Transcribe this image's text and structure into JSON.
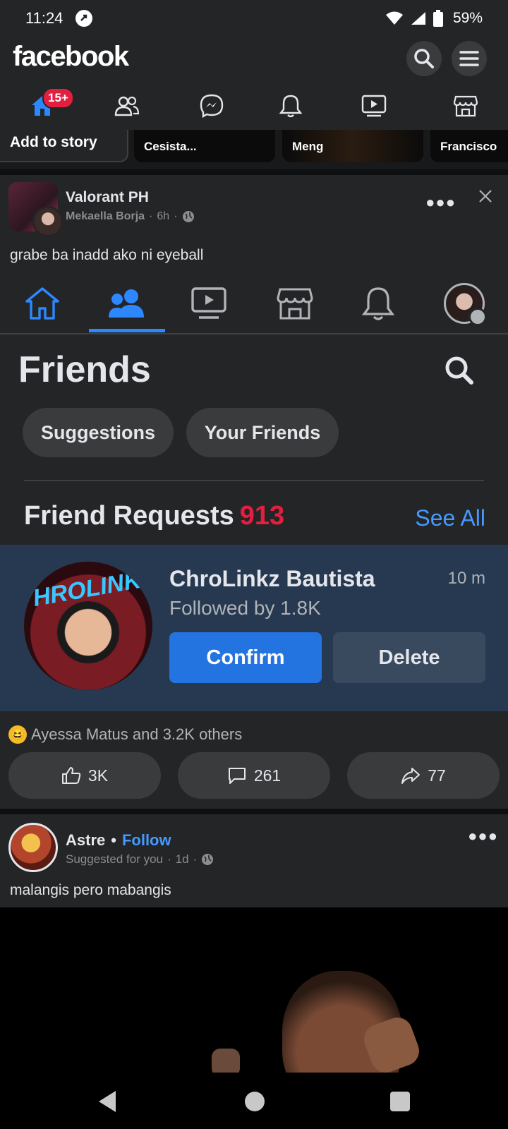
{
  "status": {
    "time": "11:24",
    "battery": "59%"
  },
  "header": {
    "logo": "facebook",
    "notif_badge": "15+"
  },
  "stories": [
    {
      "label": "Add to story"
    },
    {
      "label": "Cesista..."
    },
    {
      "label": "Meng"
    },
    {
      "label": "Francisco"
    }
  ],
  "post1": {
    "title": "Valorant PH",
    "author": "Mekaella Borja",
    "time": "6h",
    "text": "grabe ba inadd ako ni eyeball",
    "screenshot": {
      "heading": "Friends",
      "chips": [
        "Suggestions",
        "Your Friends"
      ],
      "requests_label": "Friend Requests",
      "requests_count": "913",
      "see_all": "See All",
      "request": {
        "name": "ChroLinkz Bautista",
        "time": "10 m",
        "followed": "Followed by 1.8K",
        "confirm": "Confirm",
        "delete": "Delete",
        "avatar_text": "HROLINK"
      }
    },
    "reactions_text": "Ayessa Matus and 3.2K others",
    "likes": "3K",
    "comments": "261",
    "shares": "77"
  },
  "post2": {
    "name": "Astre",
    "follow": "Follow",
    "sub": "Suggested for you",
    "time": "1d",
    "text": "malangis pero mabangis"
  },
  "colors": {
    "accent": "#2d88ff",
    "badge": "#e41e3f",
    "confirm": "#2374e1"
  }
}
